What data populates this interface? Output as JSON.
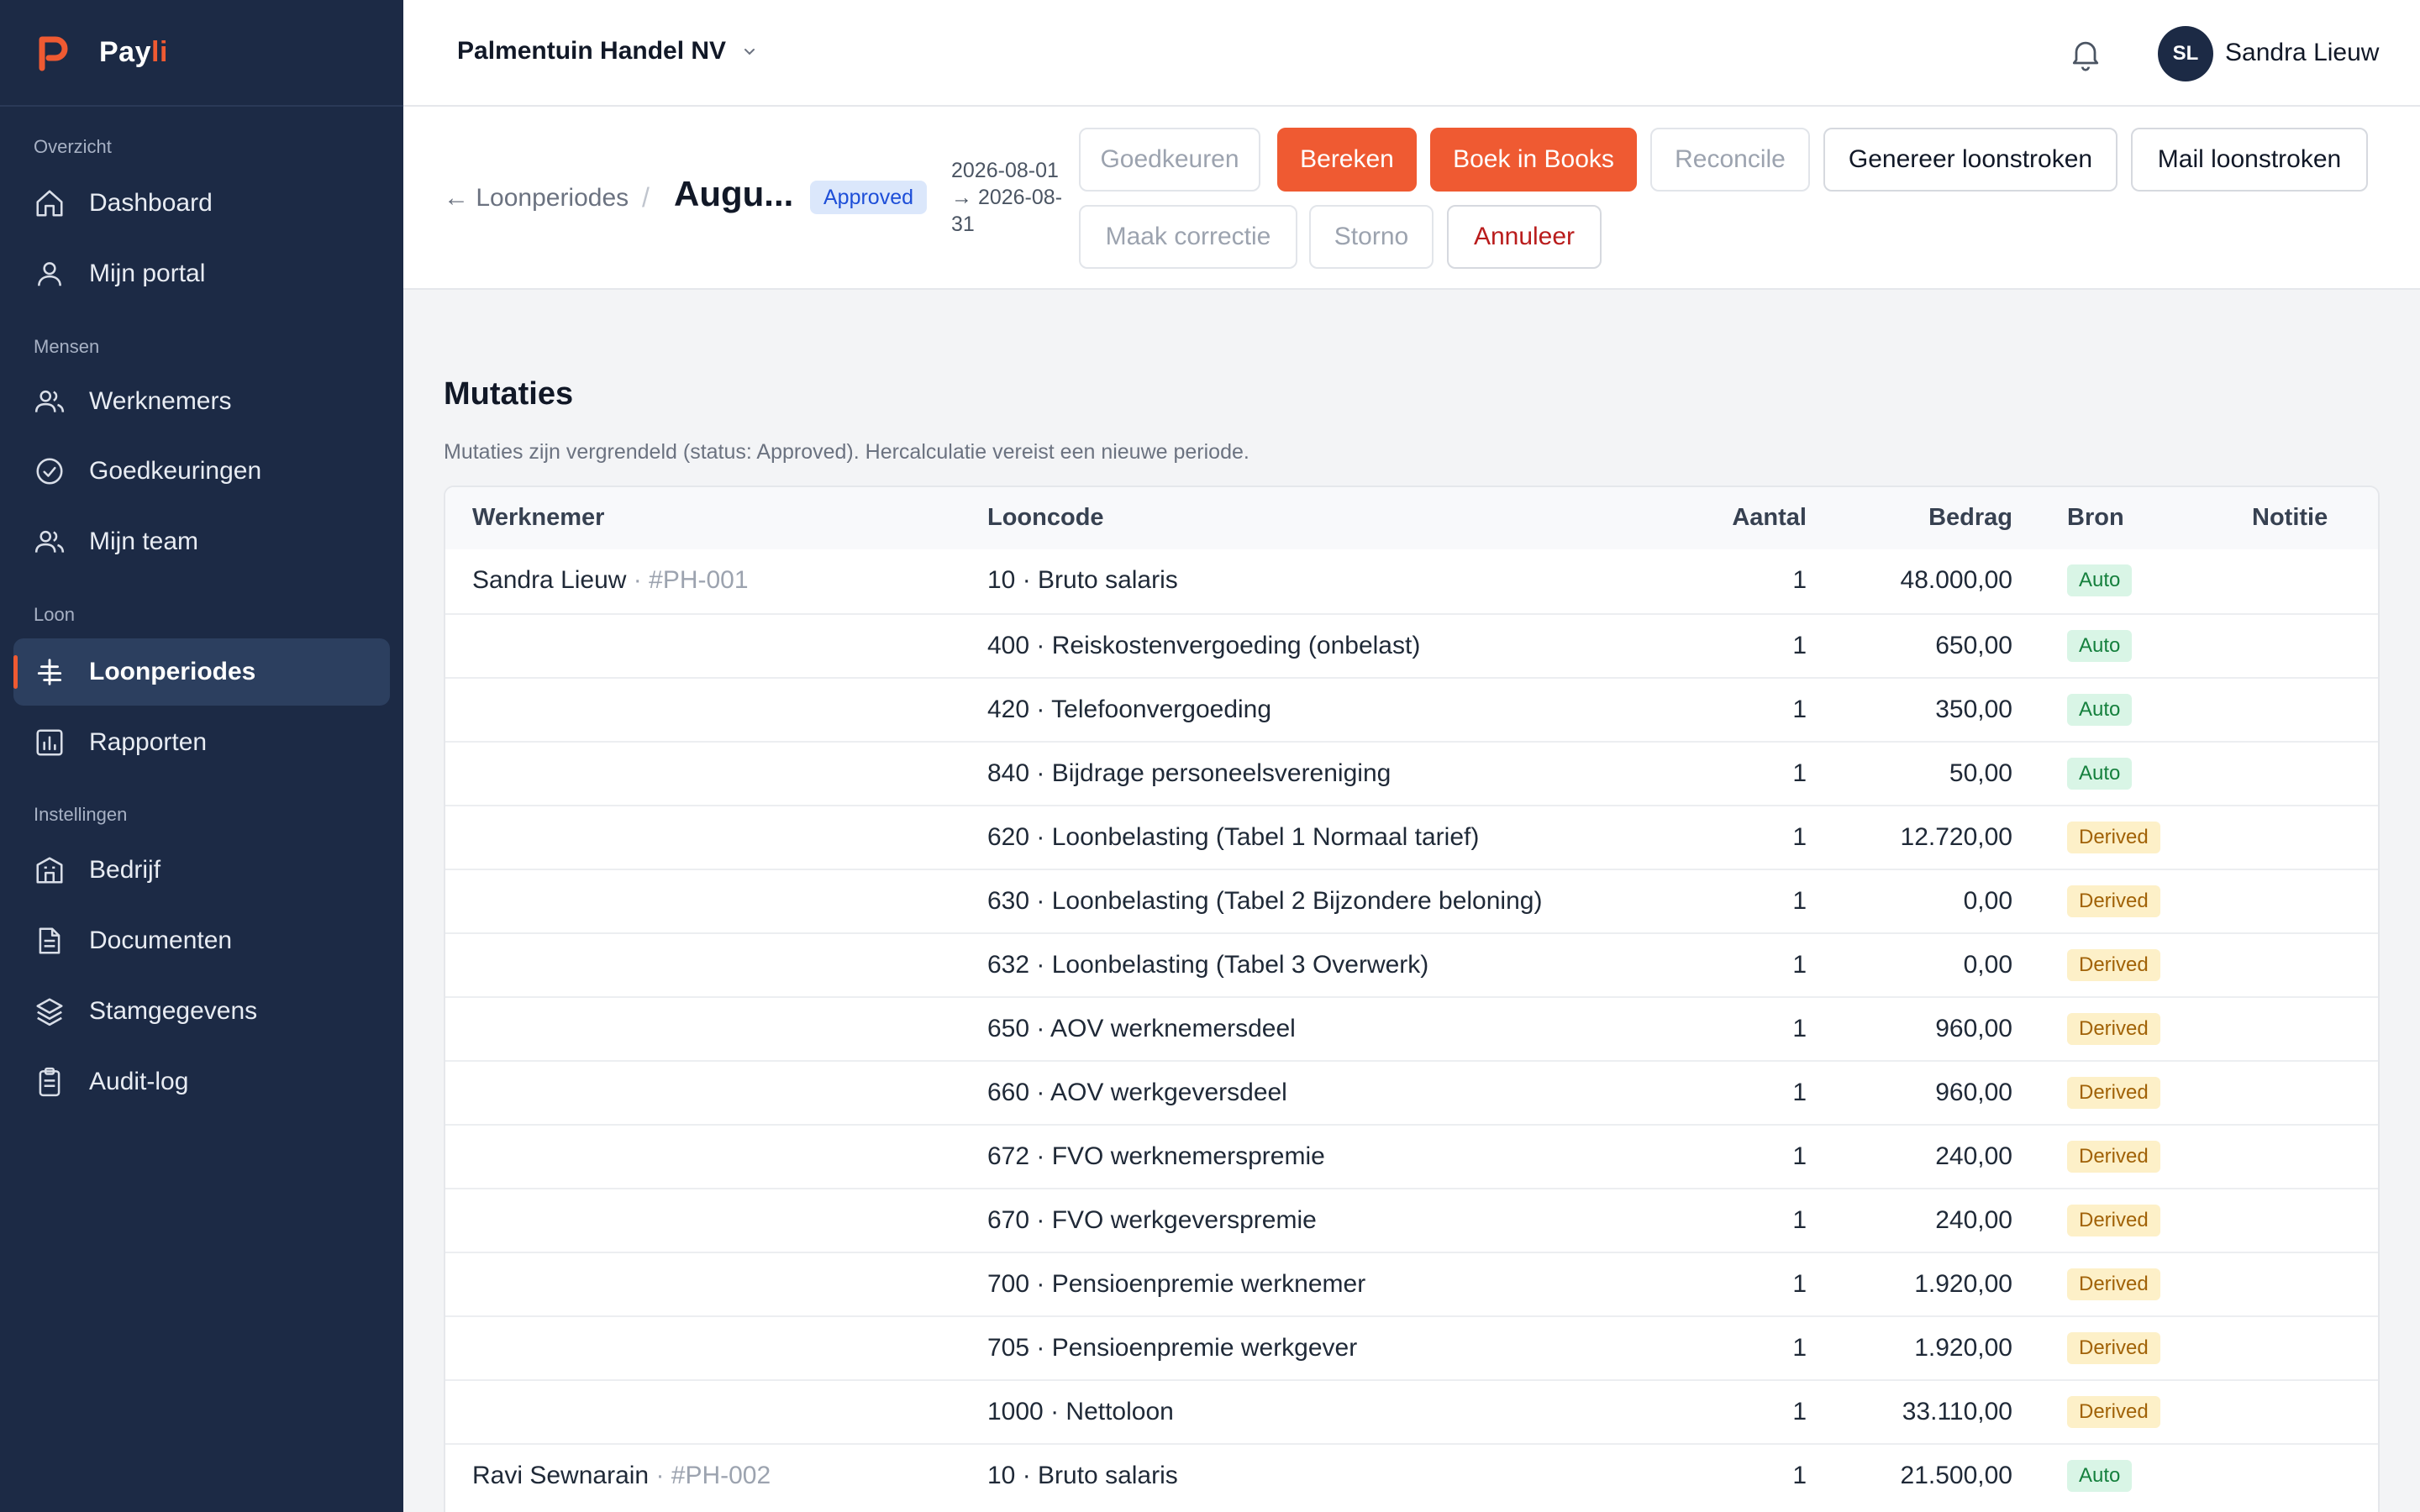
{
  "app": {
    "name_prefix": "Pay",
    "name_accent": "li"
  },
  "sidebar": {
    "sections": [
      {
        "label": "Overzicht"
      },
      {
        "label": "Mensen"
      },
      {
        "label": "Loon"
      },
      {
        "label": "Instellingen"
      }
    ],
    "items": [
      {
        "label": "Dashboard",
        "icon": "home-icon"
      },
      {
        "label": "Mijn portal",
        "icon": "user-icon"
      },
      {
        "label": "Werknemers",
        "icon": "users-icon"
      },
      {
        "label": "Goedkeuringen",
        "icon": "check-circle-icon"
      },
      {
        "label": "Mijn team",
        "icon": "team-icon"
      },
      {
        "label": "Loonperiodes",
        "icon": "payroll-icon",
        "active": true
      },
      {
        "label": "Rapporten",
        "icon": "chart-icon"
      },
      {
        "label": "Bedrijf",
        "icon": "building-icon"
      },
      {
        "label": "Documenten",
        "icon": "document-icon"
      },
      {
        "label": "Stamgegevens",
        "icon": "layers-icon"
      },
      {
        "label": "Audit-log",
        "icon": "clipboard-icon"
      }
    ]
  },
  "topbar": {
    "company": "Palmentuin Handel NV",
    "user_initials": "SL",
    "user_name": "Sandra Lieuw"
  },
  "header": {
    "back_label": "← Loonperiodes",
    "separator": "/",
    "title": "Augu...",
    "status": "Approved",
    "date_start": "2026-08-01",
    "date_end_line1": "→ 2026-08-",
    "date_end_line2": "31",
    "actions": {
      "approve": "Goedkeuren",
      "calculate": "Bereken",
      "book": "Boek in Books",
      "reconcile": "Reconcile",
      "generate_payslips": "Genereer loonstroken",
      "mail_payslips": "Mail loonstroken",
      "correction": "Maak correctie",
      "storno": "Storno",
      "cancel": "Annuleer"
    }
  },
  "mutations": {
    "title": "Mutaties",
    "note": "Mutaties zijn vergrendeld (status: Approved). Hercalculatie vereist een nieuwe periode.",
    "columns": {
      "employee": "Werknemer",
      "code": "Looncode",
      "qty": "Aantal",
      "amount": "Bedrag",
      "source": "Bron",
      "note": "Notitie"
    },
    "rows": [
      {
        "employee": "Sandra Lieuw",
        "emp_id": " · #PH-001",
        "code": "10 · Bruto salaris",
        "qty": "1",
        "amount": "48.000,00",
        "source": "Auto"
      },
      {
        "employee": "",
        "emp_id": "",
        "code": "400 · Reiskostenvergoeding (onbelast)",
        "qty": "1",
        "amount": "650,00",
        "source": "Auto"
      },
      {
        "employee": "",
        "emp_id": "",
        "code": "420 · Telefoonvergoeding",
        "qty": "1",
        "amount": "350,00",
        "source": "Auto"
      },
      {
        "employee": "",
        "emp_id": "",
        "code": "840 · Bijdrage personeelsvereniging",
        "qty": "1",
        "amount": "50,00",
        "source": "Auto"
      },
      {
        "employee": "",
        "emp_id": "",
        "code": "620 · Loonbelasting (Tabel 1 Normaal tarief)",
        "qty": "1",
        "amount": "12.720,00",
        "source": "Derived"
      },
      {
        "employee": "",
        "emp_id": "",
        "code": "630 · Loonbelasting (Tabel 2 Bijzondere beloning)",
        "qty": "1",
        "amount": "0,00",
        "source": "Derived"
      },
      {
        "employee": "",
        "emp_id": "",
        "code": "632 · Loonbelasting (Tabel 3 Overwerk)",
        "qty": "1",
        "amount": "0,00",
        "source": "Derived"
      },
      {
        "employee": "",
        "emp_id": "",
        "code": "650 · AOV werknemersdeel",
        "qty": "1",
        "amount": "960,00",
        "source": "Derived"
      },
      {
        "employee": "",
        "emp_id": "",
        "code": "660 · AOV werkgeversdeel",
        "qty": "1",
        "amount": "960,00",
        "source": "Derived"
      },
      {
        "employee": "",
        "emp_id": "",
        "code": "672 · FVO werknemerspremie",
        "qty": "1",
        "amount": "240,00",
        "source": "Derived"
      },
      {
        "employee": "",
        "emp_id": "",
        "code": "670 · FVO werkgeverspremie",
        "qty": "1",
        "amount": "240,00",
        "source": "Derived"
      },
      {
        "employee": "",
        "emp_id": "",
        "code": "700 · Pensioenpremie werknemer",
        "qty": "1",
        "amount": "1.920,00",
        "source": "Derived"
      },
      {
        "employee": "",
        "emp_id": "",
        "code": "705 · Pensioenpremie werkgever",
        "qty": "1",
        "amount": "1.920,00",
        "source": "Derived"
      },
      {
        "employee": "",
        "emp_id": "",
        "code": "1000 · Nettoloon",
        "qty": "1",
        "amount": "33.110,00",
        "source": "Derived"
      },
      {
        "employee": "Ravi Sewnarain",
        "emp_id": " · #PH-002",
        "code": "10 · Bruto salaris",
        "qty": "1",
        "amount": "21.500,00",
        "source": "Auto"
      }
    ]
  }
}
